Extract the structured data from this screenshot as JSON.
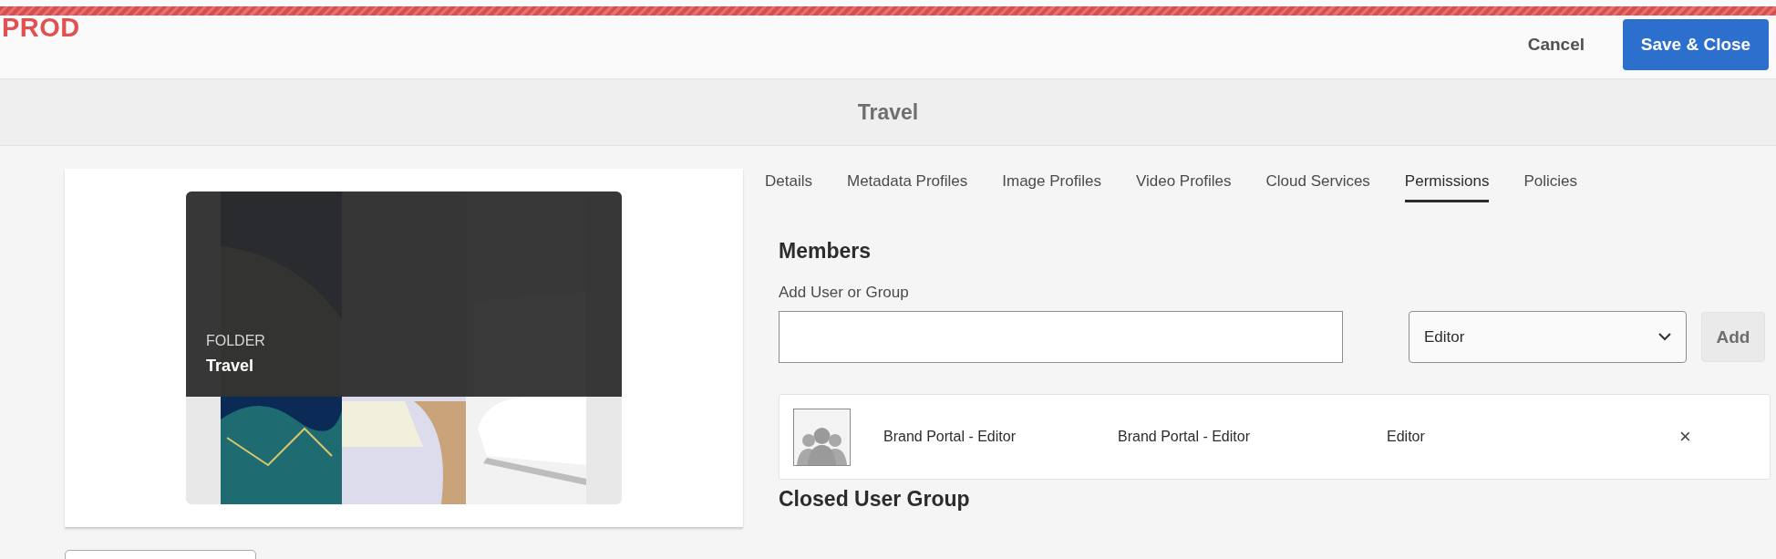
{
  "environment_badge": "PROD",
  "header": {
    "buttons": [
      {
        "label": "Cancel",
        "kind": "quiet"
      },
      {
        "label": "Save & Close",
        "kind": "primary"
      }
    ]
  },
  "title": "Travel",
  "folder_card": {
    "type_label": "FOLDER",
    "name": "Travel"
  },
  "tabs": [
    {
      "label": "Details",
      "selected": false
    },
    {
      "label": "Metadata Profiles",
      "selected": false
    },
    {
      "label": "Image Profiles",
      "selected": false
    },
    {
      "label": "Video Profiles",
      "selected": false
    },
    {
      "label": "Cloud Services",
      "selected": false
    },
    {
      "label": "Permissions",
      "selected": true
    },
    {
      "label": "Policies",
      "selected": false
    }
  ],
  "members": {
    "heading": "Members",
    "add_label": "Add User or Group",
    "role_select": {
      "value": "Editor"
    },
    "add_button": "Add",
    "rows": [
      {
        "name": "Brand Portal - Editor",
        "column_2": "Brand Portal - Editor",
        "role": "Editor",
        "remove": "×"
      }
    ]
  },
  "closed_user_group": {
    "heading": "Closed User Group"
  }
}
